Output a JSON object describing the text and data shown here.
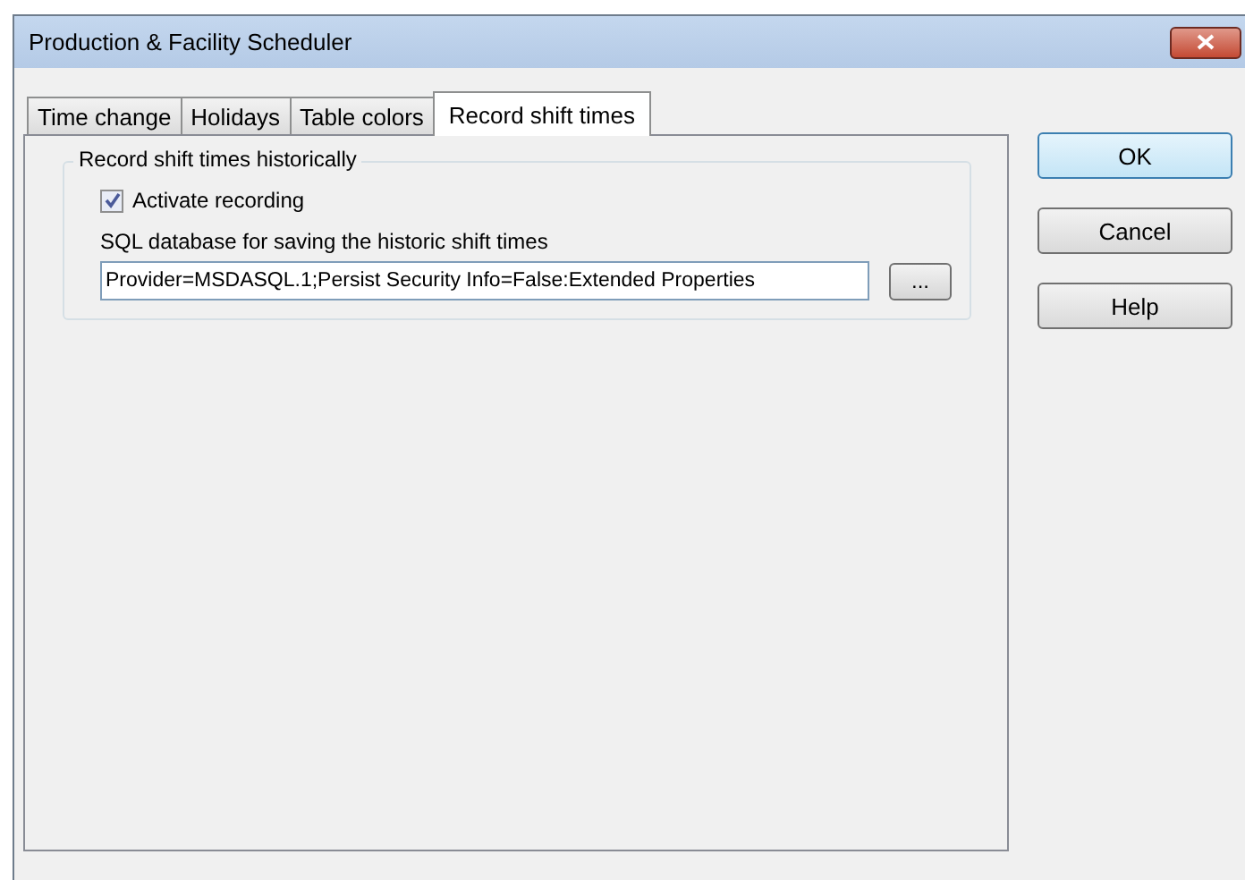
{
  "window": {
    "title": "Production & Facility Scheduler"
  },
  "tabs": [
    {
      "label": "Time change",
      "selected": false
    },
    {
      "label": "Holidays",
      "selected": false
    },
    {
      "label": "Table colors",
      "selected": false
    },
    {
      "label": "Record shift times",
      "selected": true
    }
  ],
  "group": {
    "title": "Record shift times historically",
    "checkbox": {
      "label": "Activate recording",
      "checked": true
    },
    "field_label": "SQL database for saving the historic shift times",
    "field": {
      "value": "Provider=MSDASQL.1;Persist Security Info=False:Extended Properties"
    },
    "browse_button": "..."
  },
  "buttons": [
    {
      "label": "OK",
      "default": true
    },
    {
      "label": "Cancel",
      "default": false
    },
    {
      "label": "Help",
      "default": false
    }
  ]
}
